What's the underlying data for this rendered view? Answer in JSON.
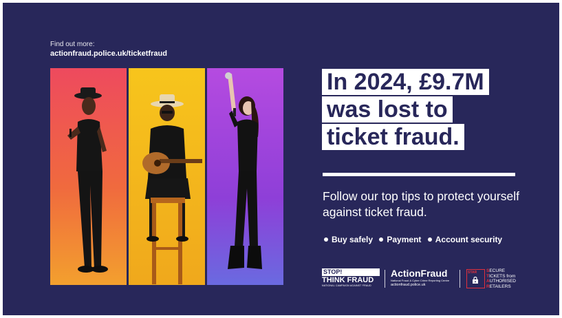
{
  "find_out": {
    "label": "Find out more:",
    "url": "actionfraud.police.uk/ticketfraud"
  },
  "headline": [
    "In 2024, £9.7M",
    "was lost to",
    "ticket fraud."
  ],
  "subtext": "Follow our top tips to protect yourself against ticket fraud.",
  "tips": [
    "Buy safely",
    "Payment",
    "Account security"
  ],
  "logos": {
    "stop_think": {
      "line1": "STOP!",
      "line2": "THINK FRAUD",
      "caption": "NATIONAL CAMPAIGN AGAINST FRAUD"
    },
    "action_fraud": {
      "name": "ActionFraud",
      "descriptor": "National Fraud & Cyber Crime Reporting Centre",
      "url": "actionfraud.police.uk"
    },
    "star": {
      "badge": "STAR",
      "lines": [
        {
          "initial": "S",
          "rest": "ECURE"
        },
        {
          "initial": "T",
          "rest": "ICKETS from"
        },
        {
          "initial": "A",
          "rest": "UTHORISED"
        },
        {
          "initial": "R",
          "rest": "ETAILERS"
        }
      ]
    }
  },
  "colors": {
    "background": "#28275a",
    "panel_red": "#ee4a5e",
    "panel_yellow": "#f7c51c",
    "panel_purple": "#b54be0",
    "text": "#ffffff",
    "star_red": "#e2303c"
  },
  "images": [
    "singer-with-microphone",
    "guitarist-on-stool",
    "singer-in-leather-outfit"
  ]
}
